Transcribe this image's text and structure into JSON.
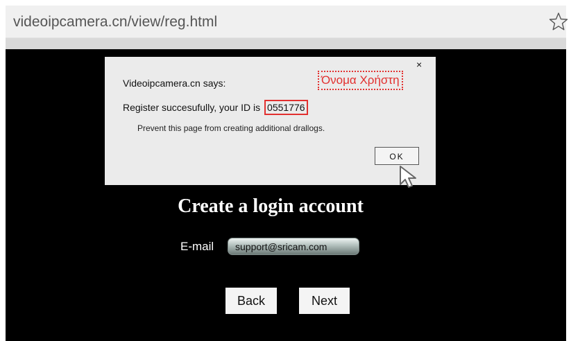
{
  "browser": {
    "url": "videoipcamera.cn/view/reg.html",
    "bookmark_icon": "star-outline-icon"
  },
  "dialog": {
    "title": "Videoipcamera.cn says:",
    "message_prefix": "Register succesufully, your ID is",
    "user_id": "0551776",
    "note": "Prevent this page from  creating additional drallogs.",
    "close_label": "×",
    "ok_label": "OK",
    "annotation_label": "Όνομα Χρήστη",
    "annotation_color": "#e2302f"
  },
  "page": {
    "heading": "Create a login account",
    "email_label": "E-mail",
    "email_value": "support@sricam.com",
    "back_label": "Back",
    "next_label": "Next",
    "background_color": "#000000"
  }
}
